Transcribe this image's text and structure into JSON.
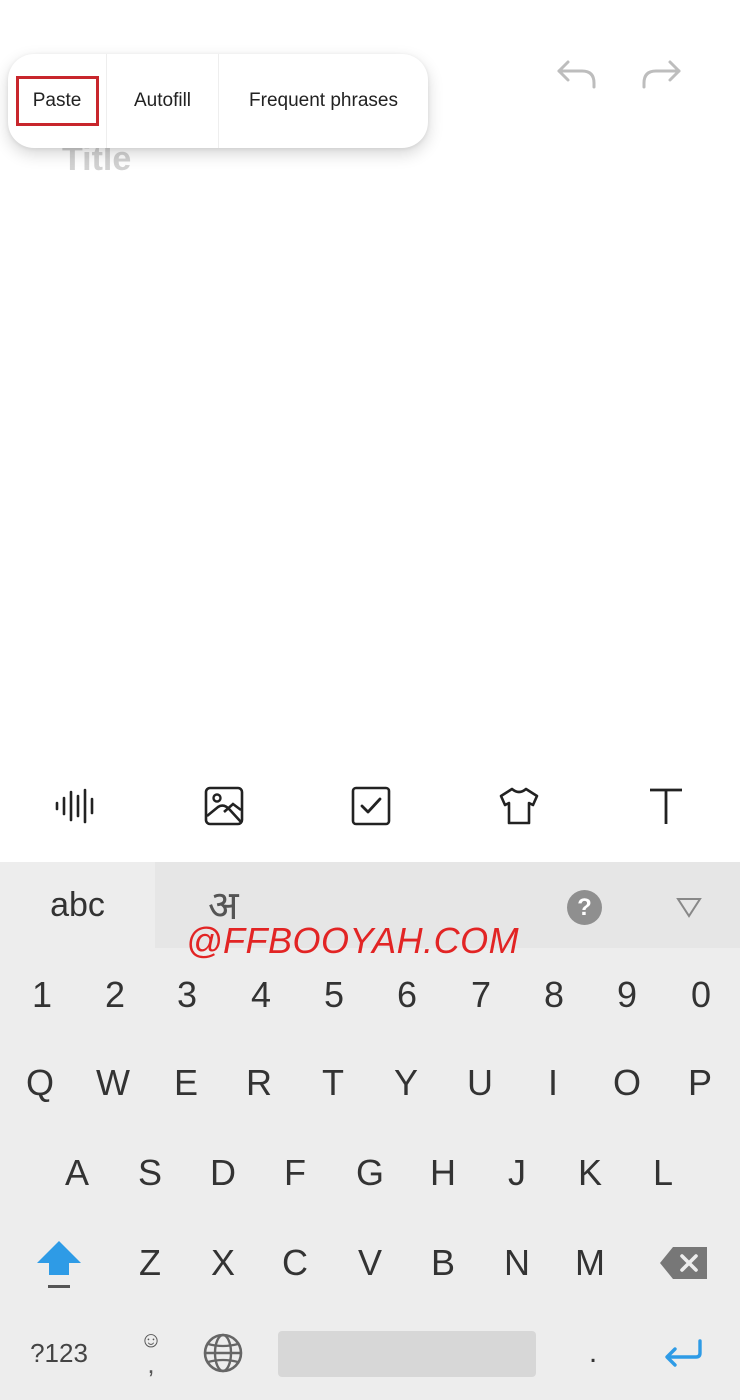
{
  "popup_menu": {
    "items": [
      {
        "label": "Paste"
      },
      {
        "label": "Autofill"
      },
      {
        "label": "Frequent phrases"
      }
    ]
  },
  "editor": {
    "title_placeholder": "Title"
  },
  "toolbar": {
    "icons": [
      "voice-input-icon",
      "image-icon",
      "checkbox-icon",
      "shirt-icon",
      "text-format-icon"
    ]
  },
  "keyboard": {
    "lang_abc": "abc",
    "lang_hindi": "अ",
    "help_label": "?",
    "watermark": "@FFBOOYAH.COM",
    "number_row": [
      "1",
      "2",
      "3",
      "4",
      "5",
      "6",
      "7",
      "8",
      "9",
      "0"
    ],
    "row1": [
      "Q",
      "W",
      "E",
      "R",
      "T",
      "Y",
      "U",
      "I",
      "O",
      "P"
    ],
    "row2": [
      "A",
      "S",
      "D",
      "F",
      "G",
      "H",
      "J",
      "K",
      "L"
    ],
    "row3": [
      "Z",
      "X",
      "C",
      "V",
      "B",
      "N",
      "M"
    ],
    "symbols_key": "?123",
    "emoji_top": "☺",
    "emoji_bottom": ",",
    "period_key": "."
  },
  "colors": {
    "highlight": "#c8262c",
    "watermark": "#e22424",
    "accent": "#2e9be6"
  }
}
